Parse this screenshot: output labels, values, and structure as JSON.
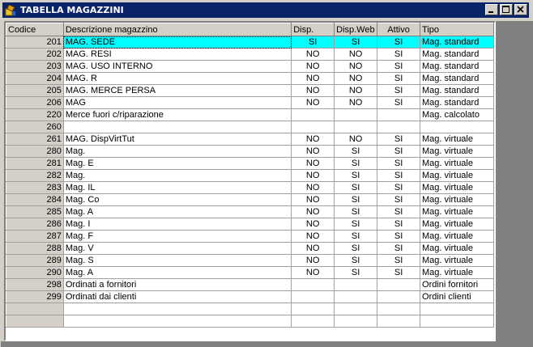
{
  "window": {
    "title": "TABELLA MAGAZZINI",
    "minimize_label": "_",
    "maximize_label": "□",
    "close_label": "✕"
  },
  "columns": {
    "codice": "Codice",
    "descrizione": "Descrizione magazzino",
    "disp": "Disp.",
    "disp_web": "Disp.Web",
    "attivo": "Attivo",
    "tipo": "Tipo"
  },
  "rows": [
    {
      "code": "201",
      "desc": "MAG. SEDE",
      "disp": "SI",
      "web": "SI",
      "att": "SI",
      "tipo": "Mag. standard",
      "selected": true
    },
    {
      "code": "202",
      "desc": "MAG. RESI",
      "disp": "NO",
      "web": "NO",
      "att": "SI",
      "tipo": "Mag. standard"
    },
    {
      "code": "203",
      "desc": "MAG. USO INTERNO",
      "disp": "NO",
      "web": "NO",
      "att": "SI",
      "tipo": "Mag. standard"
    },
    {
      "code": "204",
      "desc": "MAG. R",
      "disp": "NO",
      "web": "NO",
      "att": "SI",
      "tipo": "Mag. standard"
    },
    {
      "code": "205",
      "desc": "MAG. MERCE PERSA",
      "disp": "NO",
      "web": "NO",
      "att": "SI",
      "tipo": "Mag. standard"
    },
    {
      "code": "206",
      "desc": "MAG",
      "disp": "NO",
      "web": "NO",
      "att": "SI",
      "tipo": "Mag. standard"
    },
    {
      "code": "220",
      "desc": "Merce fuori c/riparazione",
      "disp": "",
      "web": "",
      "att": "",
      "tipo": "Mag. calcolato"
    },
    {
      "code": "260",
      "desc": "",
      "disp": "",
      "web": "",
      "att": "",
      "tipo": ""
    },
    {
      "code": "261",
      "desc": "MAG. DispVirtTut",
      "disp": "NO",
      "web": "NO",
      "att": "SI",
      "tipo": "Mag. virtuale"
    },
    {
      "code": "280",
      "desc": "Mag.",
      "disp": "NO",
      "web": "SI",
      "att": "SI",
      "tipo": "Mag. virtuale"
    },
    {
      "code": "281",
      "desc": "Mag. E",
      "disp": "NO",
      "web": "SI",
      "att": "SI",
      "tipo": "Mag. virtuale"
    },
    {
      "code": "282",
      "desc": "Mag.",
      "disp": "NO",
      "web": "SI",
      "att": "SI",
      "tipo": "Mag. virtuale"
    },
    {
      "code": "283",
      "desc": "Mag. IL",
      "disp": "NO",
      "web": "SI",
      "att": "SI",
      "tipo": "Mag. virtuale"
    },
    {
      "code": "284",
      "desc": "Mag. Co",
      "disp": "NO",
      "web": "SI",
      "att": "SI",
      "tipo": "Mag. virtuale"
    },
    {
      "code": "285",
      "desc": "Mag. A",
      "disp": "NO",
      "web": "SI",
      "att": "SI",
      "tipo": "Mag. virtuale"
    },
    {
      "code": "286",
      "desc": "Mag. I",
      "disp": "NO",
      "web": "SI",
      "att": "SI",
      "tipo": "Mag. virtuale"
    },
    {
      "code": "287",
      "desc": "Mag. F",
      "disp": "NO",
      "web": "SI",
      "att": "SI",
      "tipo": "Mag. virtuale"
    },
    {
      "code": "288",
      "desc": "Mag. V",
      "disp": "NO",
      "web": "SI",
      "att": "SI",
      "tipo": "Mag. virtuale"
    },
    {
      "code": "289",
      "desc": "Mag. S",
      "disp": "NO",
      "web": "SI",
      "att": "SI",
      "tipo": "Mag. virtuale"
    },
    {
      "code": "290",
      "desc": "Mag. A",
      "disp": "NO",
      "web": "SI",
      "att": "SI",
      "tipo": "Mag. virtuale"
    },
    {
      "code": "298",
      "desc": "Ordinati a fornitori",
      "disp": "",
      "web": "",
      "att": "",
      "tipo": "Ordini fornitori"
    },
    {
      "code": "299",
      "desc": "Ordinati dai clienti",
      "disp": "",
      "web": "",
      "att": "",
      "tipo": "Ordini clienti"
    }
  ],
  "colors": {
    "titlebar": "#0a246a",
    "selection": "#00ffff",
    "face": "#d4d0c8"
  }
}
